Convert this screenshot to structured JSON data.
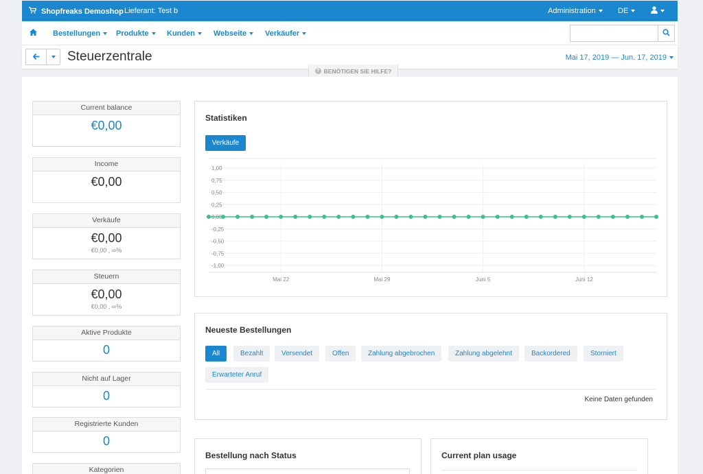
{
  "topbar": {
    "brand": "Shopfreaks Demoshop",
    "vendor": "Lieferant: Test b",
    "administration": "Administration",
    "language": "DE",
    "brand_color": "#1a87cf"
  },
  "nav": {
    "items": [
      "Bestellungen",
      "Produkte",
      "Kunden",
      "Webseite",
      "Verkäufer"
    ],
    "search_placeholder": ""
  },
  "header": {
    "title": "Steuerzentrale",
    "date_range": "Mai 17, 2019 — Jun. 17, 2019",
    "help": "BENÖTIGEN SIE HILFE?"
  },
  "stats": [
    {
      "label": "Current balance",
      "value": "€0,00",
      "sub": ""
    },
    {
      "label": "Income",
      "value": "€0,00",
      "sub": ""
    },
    {
      "label": "Verkäufe",
      "value": "€0,00",
      "sub": "€0,00 , ∞%"
    },
    {
      "label": "Steuern",
      "value": "€0,00",
      "sub": "€0,00 , ∞%"
    },
    {
      "label": "Aktive Produkte",
      "value": "0",
      "sub": ""
    },
    {
      "label": "Nicht auf Lager",
      "value": "0",
      "sub": ""
    },
    {
      "label": "Registrierte Kunden",
      "value": "0",
      "sub": ""
    },
    {
      "label": "Kategorien",
      "value": "",
      "sub": ""
    }
  ],
  "statistics": {
    "title": "Statistiken",
    "button": "Verkäufe"
  },
  "chart_data": {
    "type": "line",
    "x_ticks": [
      "Mai 22",
      "Mai 29",
      "Juni 5",
      "Juni 12"
    ],
    "y_ticks": [
      "1,00",
      "0,75",
      "0,50",
      "0,25",
      "0,00",
      "-0,25",
      "-0,50",
      "-0,75",
      "-1,00"
    ],
    "ylim": [
      -1,
      1
    ],
    "x": [
      "2019-05-17",
      "2019-05-18",
      "2019-05-19",
      "2019-05-20",
      "2019-05-21",
      "2019-05-22",
      "2019-05-23",
      "2019-05-24",
      "2019-05-25",
      "2019-05-26",
      "2019-05-27",
      "2019-05-28",
      "2019-05-29",
      "2019-05-30",
      "2019-05-31",
      "2019-06-01",
      "2019-06-02",
      "2019-06-03",
      "2019-06-04",
      "2019-06-05",
      "2019-06-06",
      "2019-06-07",
      "2019-06-08",
      "2019-06-09",
      "2019-06-10",
      "2019-06-11",
      "2019-06-12",
      "2019-06-13",
      "2019-06-14",
      "2019-06-15",
      "2019-06-16",
      "2019-06-17"
    ],
    "values": [
      0,
      0,
      0,
      0,
      0,
      0,
      0,
      0,
      0,
      0,
      0,
      0,
      0,
      0,
      0,
      0,
      0,
      0,
      0,
      0,
      0,
      0,
      0,
      0,
      0,
      0,
      0,
      0,
      0,
      0,
      0,
      0
    ],
    "line_color": "#3cc08a",
    "grid": true
  },
  "orders": {
    "title": "Neueste Bestellungen",
    "filters": [
      "All",
      "Bezahlt",
      "Versendet",
      "Offen",
      "Zahlung abgebrochen",
      "Zahlung abgelehnt",
      "Backordered",
      "Storniert",
      "Erwarteter Anruf"
    ],
    "empty": "Keine Daten gefunden"
  },
  "bottom": {
    "status_title": "Bestellung nach Status",
    "plan_title": "Current plan usage"
  }
}
